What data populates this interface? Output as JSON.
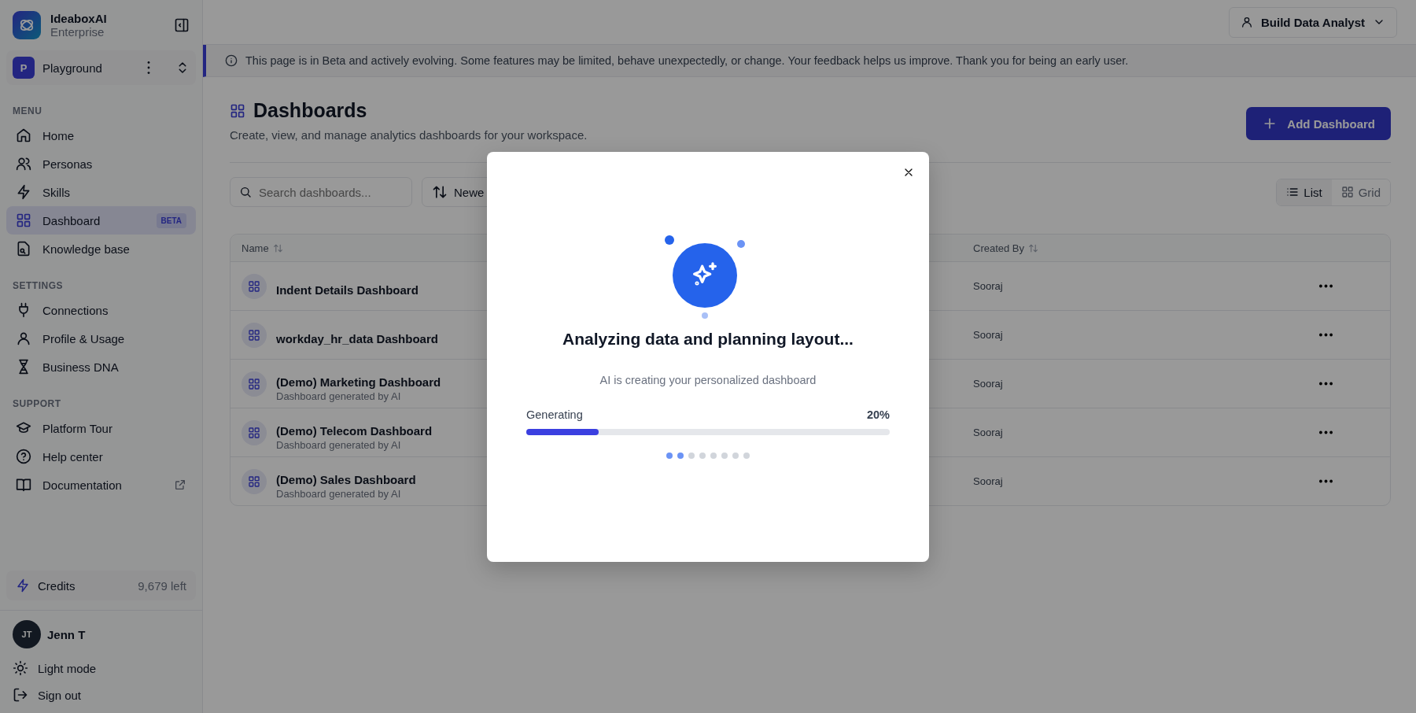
{
  "sidebar": {
    "brand": {
      "name": "IdeaboxAI",
      "plan": "Enterprise"
    },
    "workspace": {
      "initial": "P",
      "name": "Playground"
    },
    "sections": [
      {
        "label": "MENU",
        "items": [
          {
            "label": "Home",
            "selected": false
          },
          {
            "label": "Personas",
            "selected": false
          },
          {
            "label": "Skills",
            "selected": false
          },
          {
            "label": "Dashboard",
            "selected": true,
            "badge": "BETA"
          },
          {
            "label": "Knowledge base",
            "selected": false
          }
        ]
      },
      {
        "label": "SETTINGS",
        "items": [
          {
            "label": "Connections",
            "selected": false
          },
          {
            "label": "Profile & Usage",
            "selected": false
          },
          {
            "label": "Business DNA",
            "selected": false
          }
        ]
      },
      {
        "label": "SUPPORT",
        "items": [
          {
            "label": "Platform Tour",
            "selected": false
          },
          {
            "label": "Help center",
            "selected": false
          },
          {
            "label": "Documentation",
            "selected": false,
            "external": true
          }
        ]
      }
    ],
    "credits": {
      "label": "Credits",
      "value": "9,679 left"
    },
    "user": {
      "initials": "JT",
      "name": "Jenn T"
    },
    "footer": [
      "Light mode",
      "Sign out"
    ]
  },
  "top_bar": {
    "agent_button": "Build Data Analyst"
  },
  "banner": "This page is in Beta and actively evolving. Some features may be limited, behave unexpectedly, or change. Your feedback helps us improve. Thank you for being an early user.",
  "header": {
    "title": "Dashboards",
    "subtitle": "Create, view, and manage analytics dashboards for your workspace.",
    "add_button": "Add Dashboard"
  },
  "toolbar": {
    "search_placeholder": "Search dashboards...",
    "sort_button": "Newe",
    "views": [
      {
        "label": "List",
        "selected": true
      },
      {
        "label": "Grid",
        "selected": false
      }
    ]
  },
  "table": {
    "columns": [
      "Name",
      "Created By"
    ],
    "rows": [
      {
        "name": "Indent Details Dashboard",
        "created_by": "Sooraj"
      },
      {
        "name": "workday_hr_data Dashboard",
        "created_by": "Sooraj"
      },
      {
        "name": "(Demo) Marketing Dashboard",
        "description": "Dashboard generated by AI",
        "created_by": "Sooraj"
      },
      {
        "name": "(Demo) Telecom Dashboard",
        "description": "Dashboard generated by AI",
        "created_by": "Sooraj"
      },
      {
        "name": "(Demo) Sales Dashboard",
        "description": "Dashboard generated by AI",
        "created_by": "Sooraj"
      }
    ]
  },
  "modal": {
    "title": "Analyzing data and planning layout...",
    "subtitle": "AI is creating your personalized dashboard",
    "progress_label": "Generating",
    "progress_value": "20%",
    "level": 0.2,
    "steps": [
      {
        "active": true
      },
      {
        "active": true
      },
      {
        "active": false
      },
      {
        "active": false
      },
      {
        "active": false
      },
      {
        "active": false
      },
      {
        "active": false
      },
      {
        "active": false
      }
    ]
  }
}
